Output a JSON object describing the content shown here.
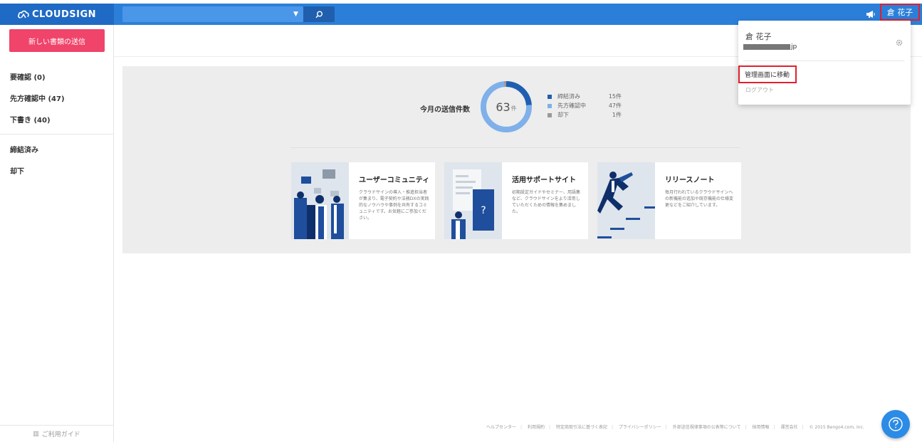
{
  "header": {
    "logo_text": "CLOUDSIGN",
    "user_label": "倉 花子",
    "search_icon": "search-icon",
    "notification_icon": "megaphone-icon"
  },
  "sidebar": {
    "new_button": "新しい書類の送信",
    "items": [
      {
        "label": "要確認 (0)"
      },
      {
        "label": "先方確認中 (47)"
      },
      {
        "label": "下書き (40)"
      },
      {
        "label": "締結済み"
      },
      {
        "label": "却下"
      }
    ],
    "guide_label": "ご利用ガイド"
  },
  "stats": {
    "label": "今月の送信件数",
    "total": "63",
    "unit": "件",
    "legend": [
      {
        "name": "締結済み",
        "count": "15件",
        "value": 15,
        "color": "#1f5fb0"
      },
      {
        "name": "先方確認中",
        "count": "47件",
        "value": 47,
        "color": "#7fb0ea"
      },
      {
        "name": "却下",
        "count": "1件",
        "value": 1,
        "color": "#999999"
      }
    ]
  },
  "cards": [
    {
      "title": "ユーザーコミュニティ",
      "desc": "クラウドサインの導入・推進担当者が集まり、電子契約や法務DXの実践的なノウハウや事例を共有するコミュニティです。お気軽にご参加ください。"
    },
    {
      "title": "活用サポートサイト",
      "desc": "初期設定ガイドやセミナー、用語集など、クラウドサインをより活用していただくための情報を集めました。"
    },
    {
      "title": "リリースノート",
      "desc": "毎月行われているクラウドサインへの新機能の追加や既存機能の仕様変更などをご紹介しています。"
    }
  ],
  "footer": {
    "links": [
      "ヘルプセンター",
      "利用規約",
      "特定商取引法に基づく表記",
      "プライバシーポリシー",
      "外部送信規律事項の公表等について",
      "採用情報",
      "運営会社"
    ],
    "copyright": "© 2015 Bengo4.com, Inc."
  },
  "dropdown": {
    "name": "倉 花子",
    "email_suffix": "jp",
    "admin_link": "管理画面に移動",
    "logout": "ログアウト"
  },
  "colors": {
    "header": "#2b7fd9",
    "accent": "#f0446a",
    "highlight": "#e0202e"
  }
}
